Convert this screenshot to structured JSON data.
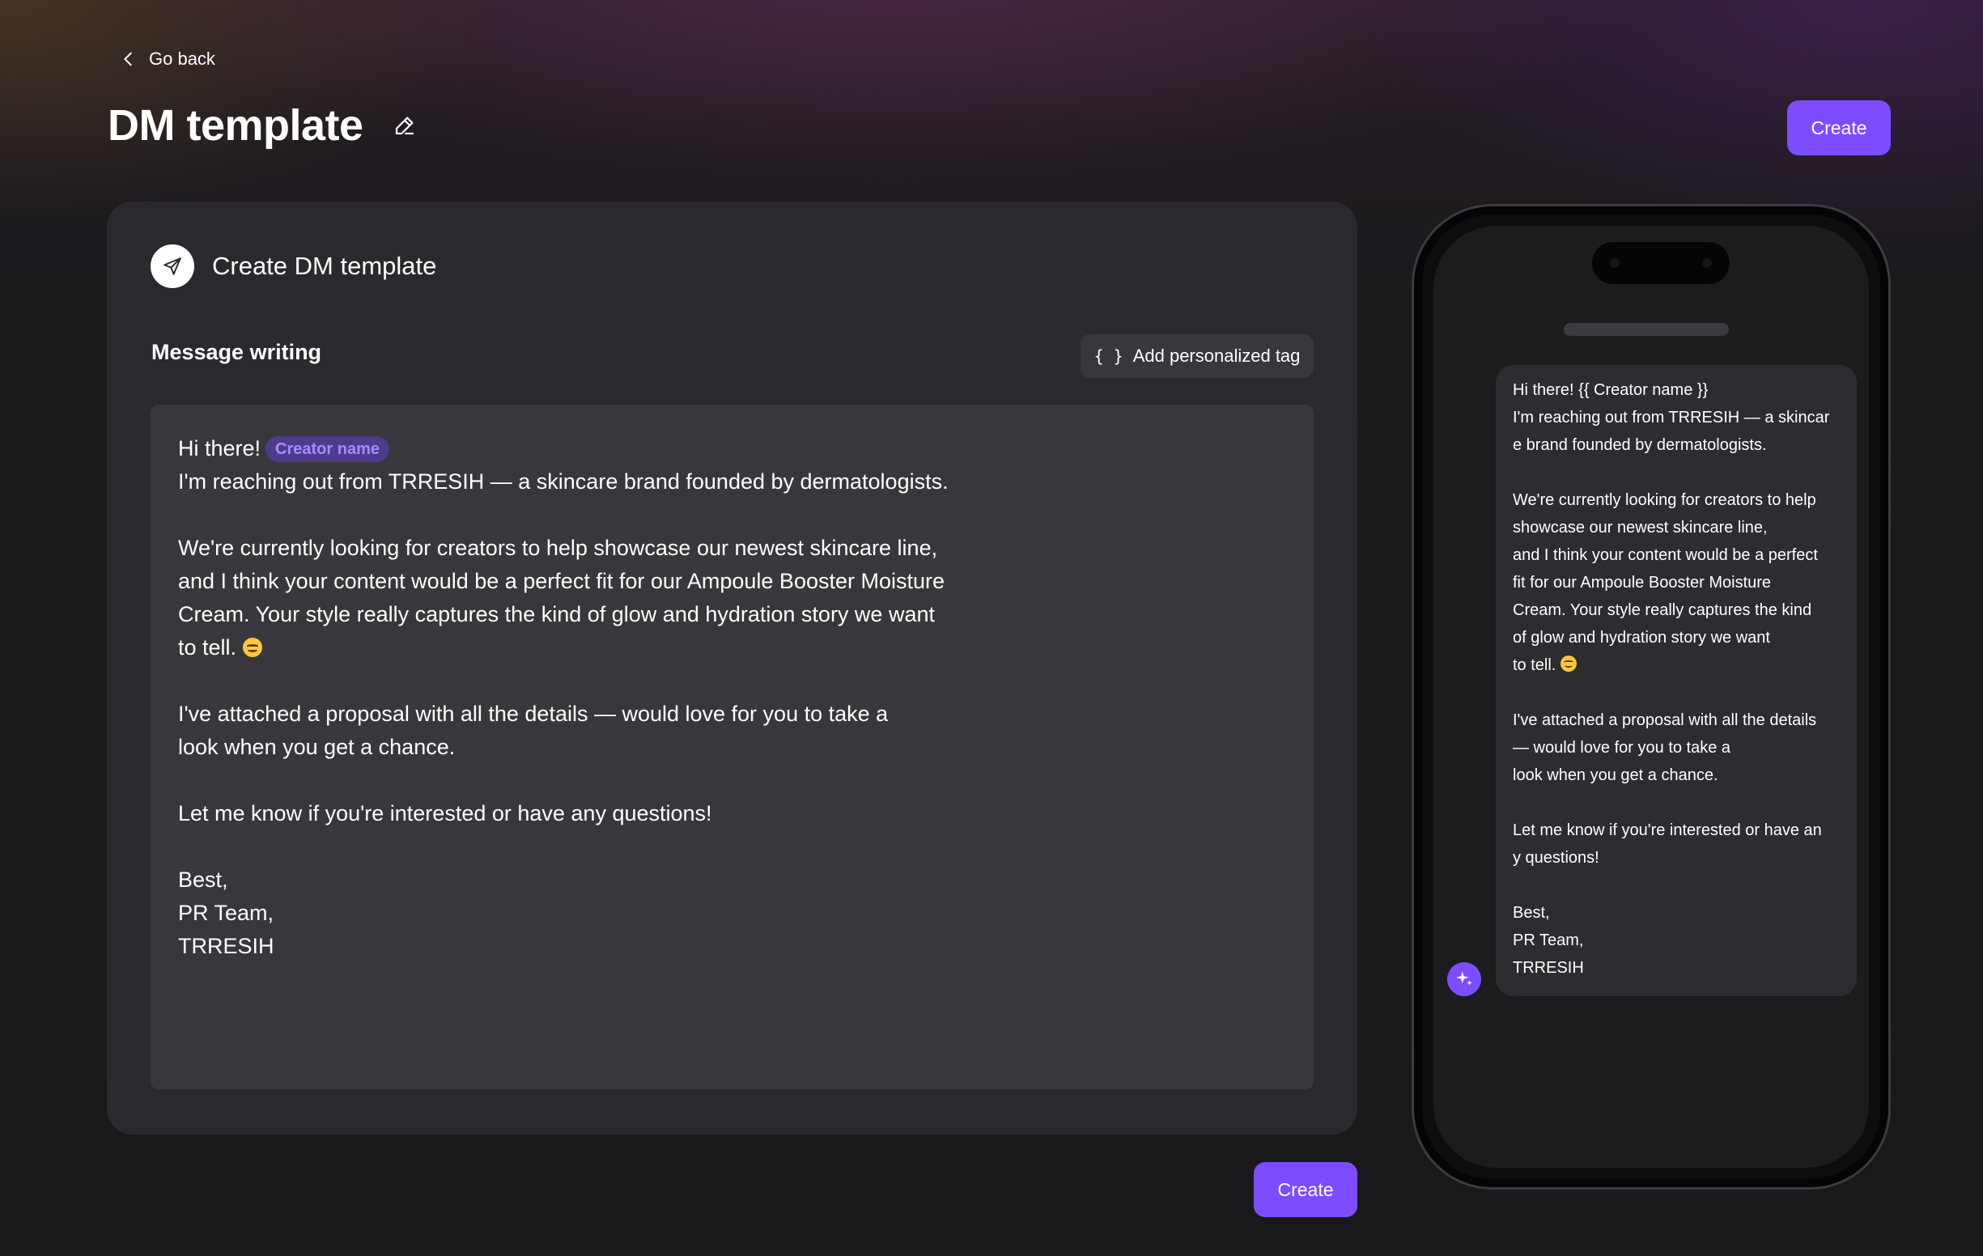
{
  "header": {
    "back_label": "Go back",
    "title": "DM template",
    "create_label": "Create"
  },
  "editor": {
    "card_title": "Create DM template",
    "section_label": "Message writing",
    "tag_button_label": "Add personalized tag",
    "tag_button_icon": "{ }",
    "creator_tag": "Creator name",
    "message": {
      "greeting": "Hi there!",
      "line1": "I'm reaching out from TRRESIH — a skincare brand founded by dermatologists.",
      "line2": "We're currently looking for creators to help showcase our newest skincare line,",
      "line3": "and I think your content would be a perfect fit for our Ampoule Booster Moisture",
      "line4": "Cream. Your style really captures the kind of glow and hydration story we want",
      "line5": "to tell. ",
      "line6": "I've attached a proposal with all the details — would love for you to take a",
      "line7": "look when you get a chance.",
      "line8": "Let me know if you're interested or have any questions!",
      "line9": "Best,",
      "line10": "PR Team,",
      "line11": "TRRESIH"
    },
    "create_label": "Create"
  },
  "preview": {
    "lines": [
      "Hi there! {{ Creator name }}",
      "I'm reaching out from TRRESIH — a skincar",
      "e brand founded by dermatologists.",
      "",
      "We're currently looking for creators to help",
      "showcase our newest skincare line,",
      "and I think your content would be a perfect",
      "fit for our Ampoule Booster Moisture",
      "Cream. Your style really captures the kind",
      "of glow and hydration story we want",
      "to tell. ",
      "",
      "I've attached a proposal with all the details",
      "— would love for you to take a",
      "look when you get a chance.",
      "",
      "Let me know if you're interested or have an",
      "y questions!",
      "",
      "Best,",
      "PR Team,",
      "TRRESIH"
    ]
  },
  "colors": {
    "accent": "#7c4dff",
    "card_bg": "#2a292d",
    "input_bg": "#38373b",
    "chip_bg": "#4e3b8c",
    "chip_text": "#a68bff"
  },
  "icons": {
    "back": "chevron-left-icon",
    "edit": "pencil-icon",
    "card": "send-icon",
    "emoji": "smiling-face-emoji",
    "ai": "sparkle-icon"
  }
}
